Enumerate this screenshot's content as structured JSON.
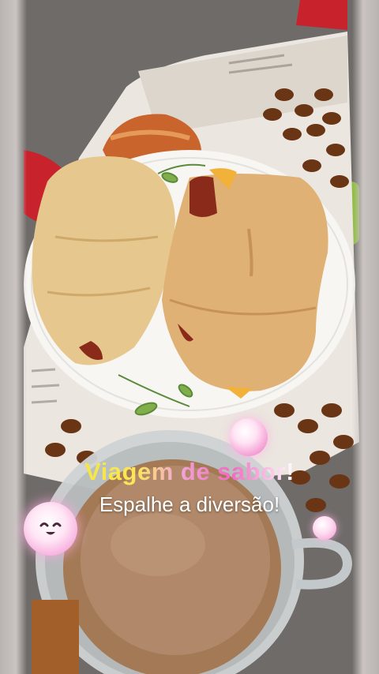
{
  "overlay": {
    "headline": "Viagem de sabor!",
    "subline": "Espalhe a diversão!"
  },
  "icons": {
    "sticker": "smiling-bubble-icon",
    "sparkles": [
      "glow-bubble-icon",
      "glow-bubble-icon"
    ]
  },
  "colors": {
    "headline_gradient": [
      "#f5e642",
      "#f06ac0",
      "#ffffff"
    ],
    "subline": "#ffffff",
    "bubble": "#f5a3d6"
  }
}
